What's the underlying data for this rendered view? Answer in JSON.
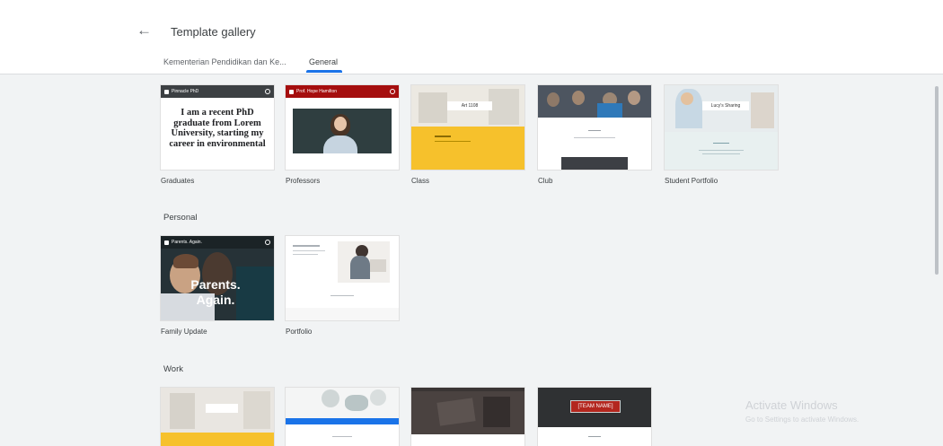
{
  "header": {
    "title": "Template gallery",
    "tabs": [
      {
        "label": "Kementerian Pendidikan dan Ke..."
      },
      {
        "label": "General"
      }
    ]
  },
  "sections": {
    "personal": "Personal",
    "work": "Work"
  },
  "templates": {
    "graduates": {
      "label": "Graduates",
      "bar_text": "Pinnacle PhD",
      "big_text": "I am a recent PhD graduate from Lorem University, starting my career in environmental"
    },
    "professors": {
      "label": "Professors",
      "bar_text": "Prof. Hope Hamilton"
    },
    "class": {
      "label": "Class",
      "banner": "Art 1108"
    },
    "club": {
      "label": "Club"
    },
    "student_portfolio": {
      "label": "Student Portfolio",
      "banner": "Lucy's Sharing Portfolio"
    },
    "family_update": {
      "label": "Family Update",
      "bar_text": "Parents. Again.",
      "overlay": "Parents. Again."
    },
    "portfolio": {
      "label": "Portfolio"
    },
    "work1": {},
    "work2": {},
    "work3": {},
    "work4": {
      "banner": "[TEAM NAME]"
    }
  },
  "watermark": {
    "title": "Activate Windows",
    "subtitle": "Go to Settings to activate Windows."
  },
  "colors": {
    "accent": "#1a73e8",
    "professors_bar": "#a50e0e",
    "class_yellow": "#f6c12c"
  }
}
